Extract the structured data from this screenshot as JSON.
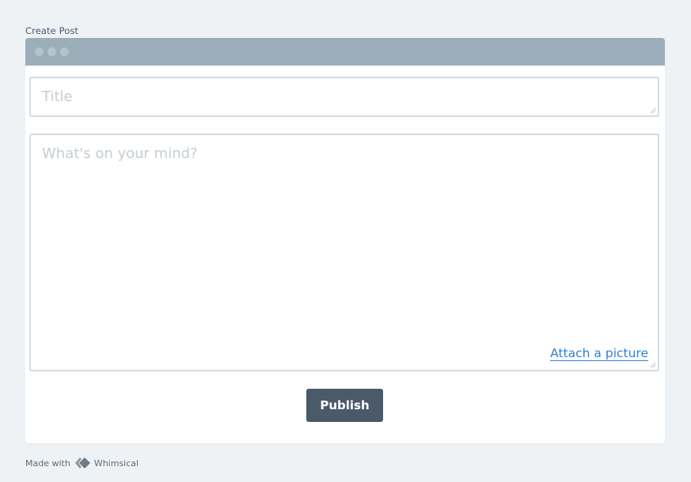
{
  "frame": {
    "label": "Create Post"
  },
  "form": {
    "title_placeholder": "Title",
    "body_placeholder": "What's on your mind?",
    "attach_label": "Attach a picture",
    "publish_label": "Publish"
  },
  "footer": {
    "made_with": "Made with",
    "brand": "Whimsical"
  },
  "colors": {
    "background": "#eef2f5",
    "titlebar": "#9caeba",
    "button": "#4a5a69",
    "link": "#2f80d6",
    "border": "#d3dbe1",
    "placeholder": "#c3cdd6"
  },
  "icons": {
    "window_controls": "traffic-light-dots",
    "resize": "resize-grip-icon",
    "brand": "whimsical-logo"
  }
}
